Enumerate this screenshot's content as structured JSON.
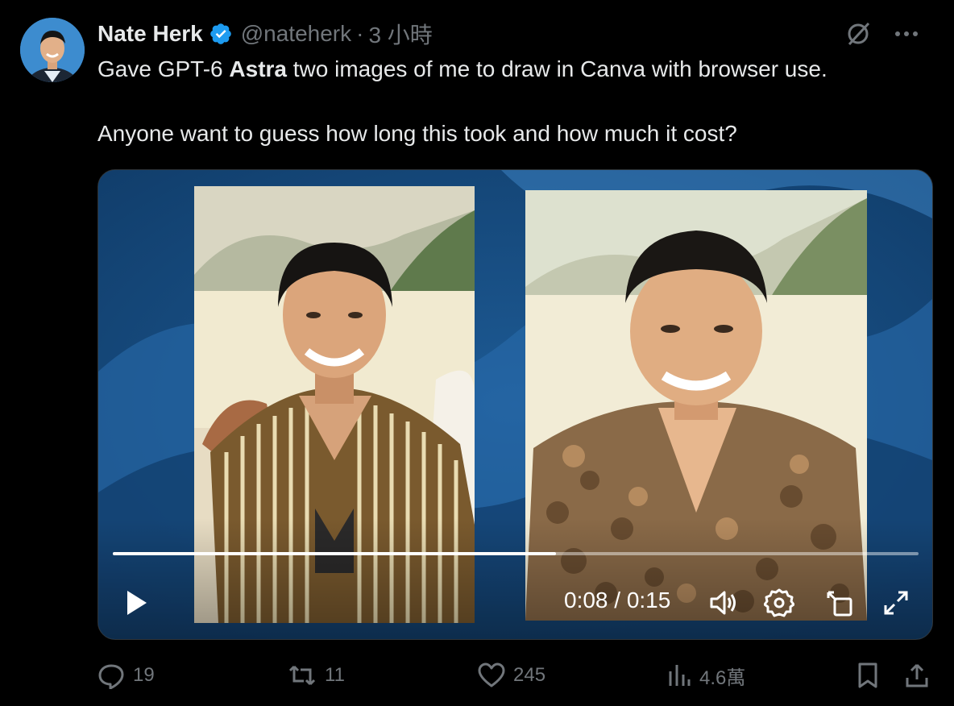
{
  "author": {
    "name": "Nate Herk",
    "handle": "@nateherk",
    "separator": "·",
    "time_ago": "3 小時",
    "verified_icon": "verified-badge-icon",
    "badge_color": "#1d9bf0"
  },
  "tweet": {
    "line1_before": "Gave GPT-6 ",
    "line1_bold": "Astra",
    "line1_after": " two images of me to draw in Canva with browser use.",
    "line2": "Anyone want to guess how long this took and how much it cost?"
  },
  "video": {
    "timecode": "0:08 / 0:15",
    "progress": 0.55,
    "icons": [
      "play-icon",
      "volume-icon",
      "settings-icon",
      "pip-icon",
      "fullscreen-icon"
    ]
  },
  "actions": {
    "replies": "19",
    "reposts": "11",
    "likes": "245",
    "views": "4.6萬"
  },
  "colors": {
    "background": "#000000",
    "text": "#e7e9ea",
    "muted": "#71767b",
    "accent": "#1d9bf0"
  }
}
